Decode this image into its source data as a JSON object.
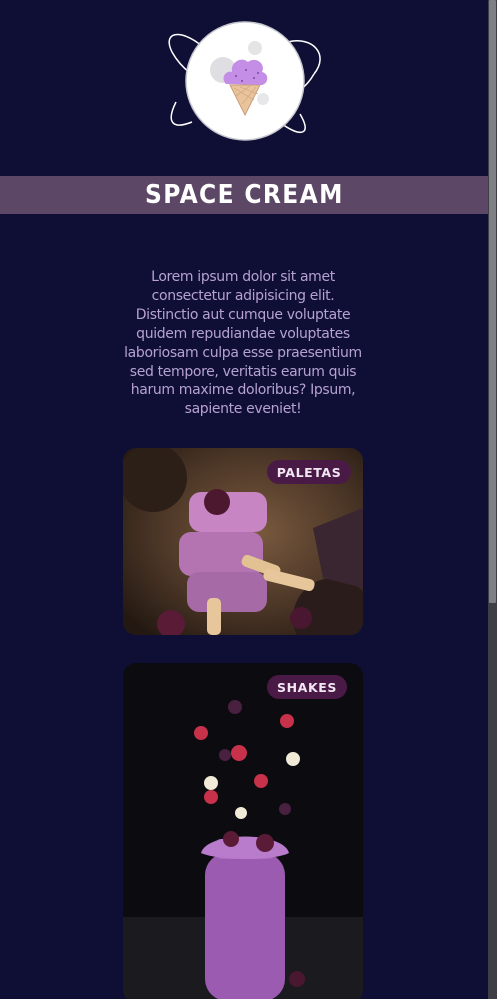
{
  "site": {
    "title": "SPACE CREAM",
    "logo_icon": "ice-cream-planet-icon",
    "colors": {
      "background": "#0f0f36",
      "title_band": "#5c4866",
      "intro_text": "#b6a2d0",
      "badge_bg": "#4a1a47",
      "badge_text": "#f1e7f3"
    }
  },
  "intro": {
    "text": "Lorem ipsum dolor sit amet consectetur adipisicing elit. Distinctio aut cumque voluptate quidem repudiandae voluptates laboriosam culpa esse praesentium sed tempore, veritatis earum quis harum maxime doloribus? Ipsum, sapiente eveniet!"
  },
  "cards": [
    {
      "badge": "PALETAS",
      "image": "stacked-berry-popsicles-photo"
    },
    {
      "badge": "SHAKES",
      "image": "berry-shake-jar-photo"
    }
  ]
}
